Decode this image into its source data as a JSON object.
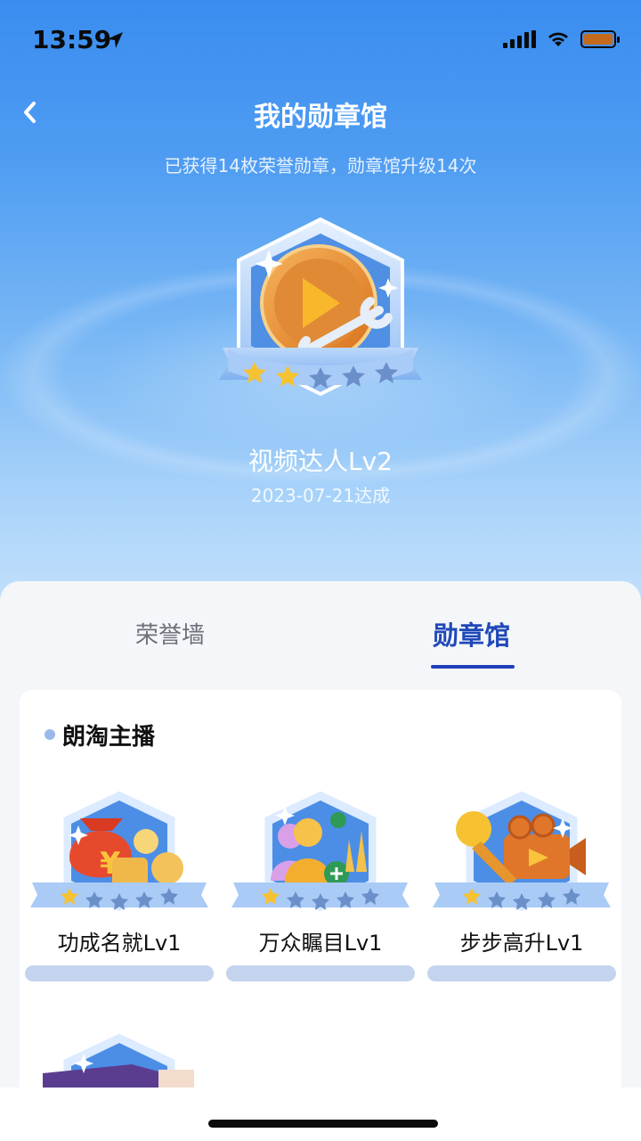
{
  "status": {
    "time": "13:59"
  },
  "header": {
    "title": "我的勋章馆",
    "subtitle": "已获得14枚荣誉勋章，勋章馆升级14次"
  },
  "featured": {
    "name": "视频达人Lv2",
    "date": "2023-07-21达成",
    "stars_lit": 2,
    "stars_total": 5
  },
  "tabs": [
    {
      "label": "荣誉墙",
      "active": false
    },
    {
      "label": "勋章馆",
      "active": true
    }
  ],
  "section": {
    "title": "朗淘主播",
    "items": [
      {
        "label": "功成名就Lv1",
        "icon": "money-bag-icon",
        "stars_lit": 1
      },
      {
        "label": "万众瞩目Lv1",
        "icon": "audience-growth-icon",
        "stars_lit": 1
      },
      {
        "label": "步步高升Lv1",
        "icon": "microphone-camera-icon",
        "stars_lit": 1
      }
    ]
  },
  "colors": {
    "accent": "#1f3fb8",
    "hero_top": "#3a8df0",
    "progress_bar": "#c4d4ee"
  }
}
